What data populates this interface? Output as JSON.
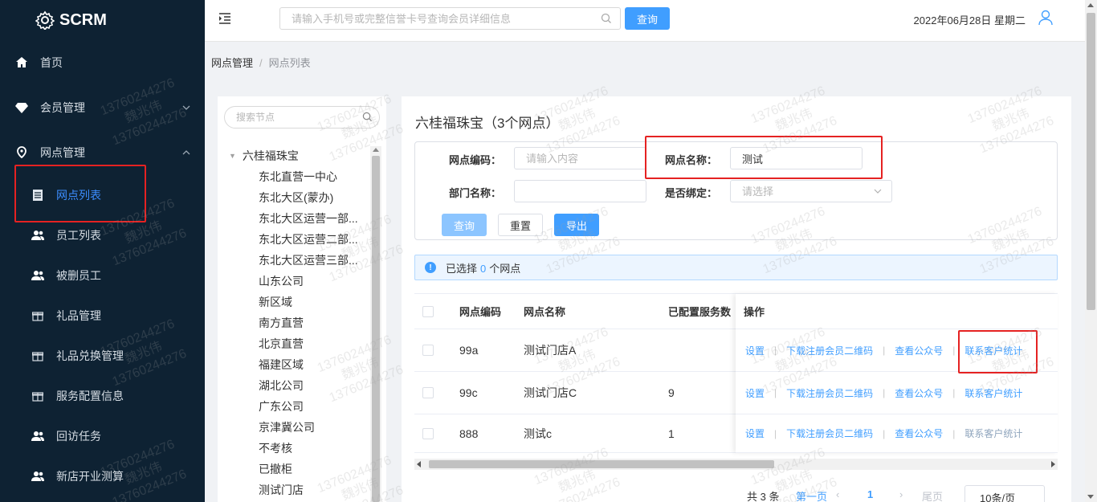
{
  "brand": {
    "name": "SCRM"
  },
  "sidebar": {
    "items": [
      {
        "label": "首页",
        "icon": "home-icon"
      },
      {
        "label": "会员管理",
        "icon": "diamond-icon"
      },
      {
        "label": "网点管理",
        "icon": "location-pin-icon"
      },
      {
        "label": "网点列表",
        "icon": "list-icon"
      },
      {
        "label": "员工列表",
        "icon": "users-icon"
      },
      {
        "label": "被删员工",
        "icon": "users-icon"
      },
      {
        "label": "礼品管理",
        "icon": "gift-icon"
      },
      {
        "label": "礼品兑换管理",
        "icon": "gift-icon"
      },
      {
        "label": "服务配置信息",
        "icon": "gift-icon"
      },
      {
        "label": "回访任务",
        "icon": "users-icon"
      },
      {
        "label": "新店开业测算",
        "icon": "users-icon"
      }
    ]
  },
  "topbar": {
    "search_placeholder": "请输入手机号或完整信誉卡号查询会员详细信息",
    "search_button": "查询",
    "date": "2022年06月28日 星期二"
  },
  "breadcrumb": {
    "parent": "网点管理",
    "current": "网点列表"
  },
  "tree": {
    "search_placeholder": "搜索节点",
    "root": "六桂福珠宝",
    "nodes": [
      "东北直营一中心",
      "东北大区(蒙办)",
      "东北大区运营一部...",
      "东北大区运营二部...",
      "东北大区运营三部...",
      "山东公司",
      "新区域",
      "南方直营",
      "北京直营",
      "福建区域",
      "湖北公司",
      "广东公司",
      "京津冀公司",
      "不考核",
      "已撤柜",
      "测试门店"
    ]
  },
  "main": {
    "title": "六桂福珠宝（3个网点）",
    "filters": {
      "code_label": "网点编码：",
      "code_placeholder": "请输入内容",
      "name_label": "网点名称：",
      "name_value": "测试",
      "dept_label": "部门名称：",
      "dept_value": "",
      "bind_label": "是否绑定：",
      "bind_placeholder": "请选择",
      "query_button": "查询",
      "reset_button": "重置",
      "export_button": "导出"
    },
    "alert": {
      "prefix": "已选择",
      "count": "0",
      "suffix": "个网点"
    },
    "table": {
      "headers": {
        "code": "网点编码",
        "name": "网点名称",
        "services": "已配置服务数",
        "ops": "操作"
      },
      "rows": [
        {
          "code": "99a",
          "name": "测试门店A",
          "services": ""
        },
        {
          "code": "99c",
          "name": "测试门店C",
          "services": "9"
        },
        {
          "code": "888",
          "name": "测试c",
          "services": "1"
        }
      ],
      "ops": {
        "settings": "设置",
        "download_qr": "下载注册会员二维码",
        "view_account": "查看公众号",
        "contact_stats": "联系客户统计"
      }
    },
    "pager": {
      "total": "共 3 条",
      "first": "第一页",
      "page": "1",
      "last": "尾页",
      "size": "10条/页"
    }
  },
  "watermark": {
    "phone": "13760244276",
    "name": "魏兆伟"
  },
  "colors": {
    "sidebar_bg": "#0e2233",
    "accent": "#409eff",
    "highlight": "#e52222"
  }
}
